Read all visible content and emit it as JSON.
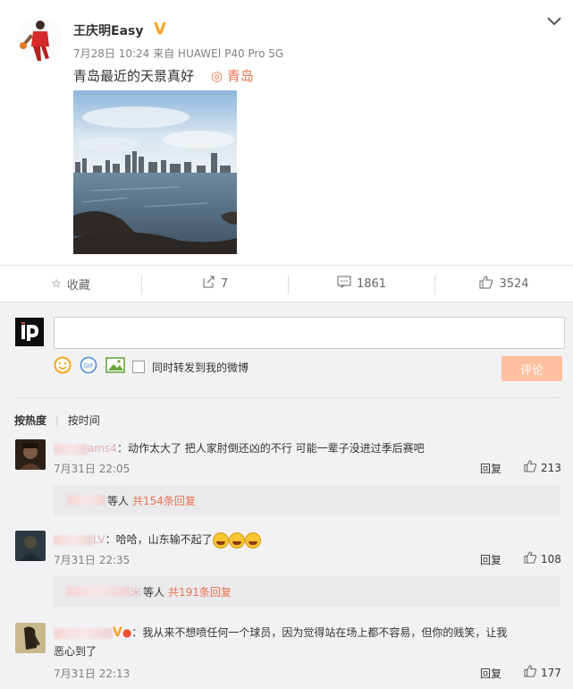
{
  "post": {
    "author": "王庆明Easy",
    "verified_badge": "V",
    "meta": "7月28日 10:24 来自 HUAWEI P40 Pro 5G",
    "text": "青岛最近的天景真好",
    "location": "青岛",
    "location_icon": "map-pin-icon",
    "menu_icon": "chevron-down-icon"
  },
  "actions": {
    "favorite": "收藏",
    "repost_count": "7",
    "comment_count": "1861",
    "like_count": "3524"
  },
  "composer": {
    "input_value": "",
    "forward_label": "同时转发到我的微博",
    "submit_label": "评论"
  },
  "sort": {
    "hot": "按热度",
    "time": "按时间"
  },
  "comments": [
    {
      "user_suffix": "ams4",
      "text": "：动作太大了 把人家肘倒还凶的不行 可能一辈子没进过季后赛吧",
      "time": "7月31日 22:05",
      "reply": "回复",
      "likes": "213",
      "sub_prefix": "等人",
      "sub_count": "共154条回复"
    },
    {
      "user_suffix": "LV",
      "text": "：哈哈，山东输不起了",
      "time": "7月31日 22:35",
      "reply": "回复",
      "likes": "108",
      "sub_user": "米",
      "sub_prefix": "等人",
      "sub_count": "共191条回复"
    },
    {
      "text": "：我从来不想喷任何一个球员，因为觉得站在场上都不容易，但你的贱笑，让我",
      "text_line2": "恶心到了",
      "time": "7月31日 22:13",
      "reply": "回复",
      "likes": "177"
    }
  ],
  "colors": {
    "accent": "#eb7350",
    "badge": "#f5a623",
    "submit": "#ffc09f"
  }
}
